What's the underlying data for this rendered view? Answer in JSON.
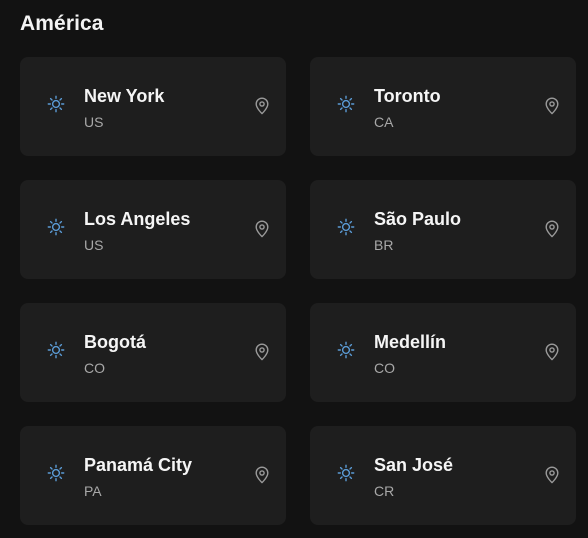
{
  "section": {
    "title": "América"
  },
  "theme": {
    "background": "#121212",
    "card": "#1e1e1e",
    "text": "#f5f5f5",
    "muted": "#a8a8a8",
    "accent": "#5b9bd5"
  },
  "icons": {
    "weather": "sun-icon",
    "location": "map-pin-icon"
  },
  "cities": [
    {
      "name": "New York",
      "country": "US"
    },
    {
      "name": "Toronto",
      "country": "CA"
    },
    {
      "name": "Los Angeles",
      "country": "US"
    },
    {
      "name": "São Paulo",
      "country": "BR"
    },
    {
      "name": "Bogotá",
      "country": "CO"
    },
    {
      "name": "Medellín",
      "country": "CO"
    },
    {
      "name": "Panamá City",
      "country": "PA"
    },
    {
      "name": "San José",
      "country": "CR"
    }
  ]
}
